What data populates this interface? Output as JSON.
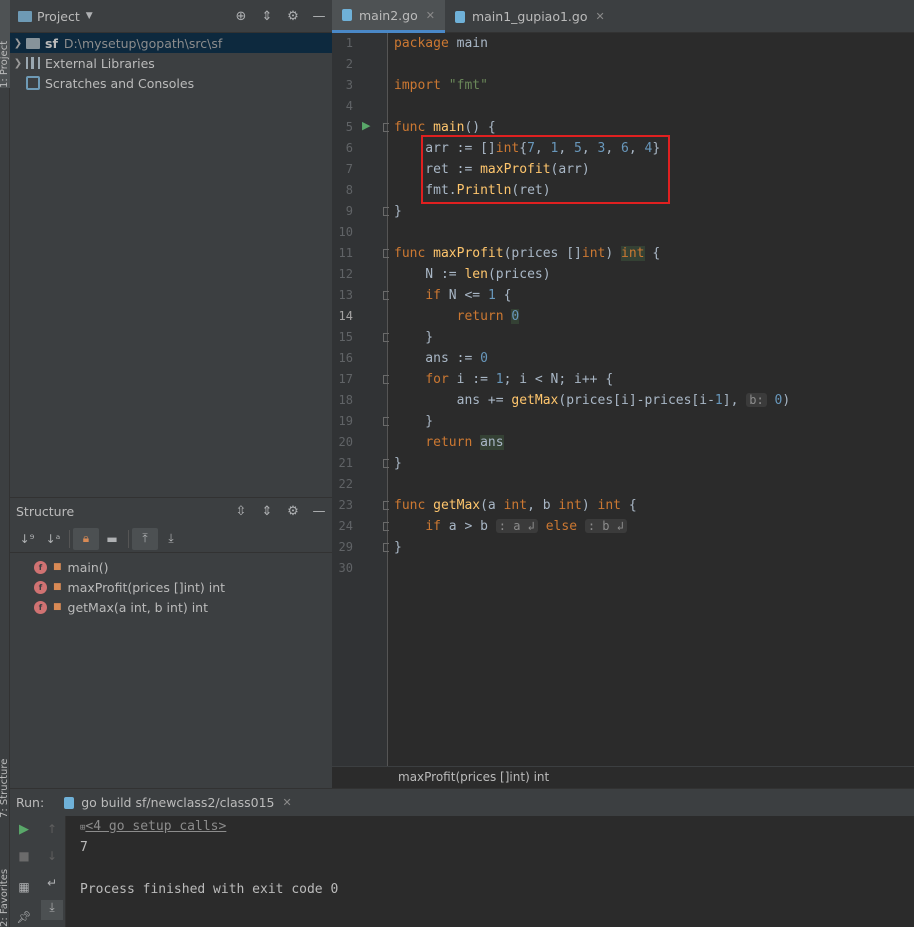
{
  "left_strip": {
    "project_tab": "1: Project",
    "structure_tab": "7: Structure",
    "favorites_tab": "2: Favorites"
  },
  "project": {
    "title": "Project",
    "tree": [
      {
        "name": "sf",
        "path": "D:\\mysetup\\gopath\\src\\sf"
      },
      {
        "name": "External Libraries"
      },
      {
        "name": "Scratches and Consoles"
      }
    ]
  },
  "structure": {
    "title": "Structure",
    "items": [
      {
        "badge": "f",
        "label": "main()"
      },
      {
        "badge": "f",
        "label": "maxProfit(prices []int) int"
      },
      {
        "badge": "f",
        "label": "getMax(a int, b int) int"
      }
    ]
  },
  "editor": {
    "tabs": [
      {
        "label": "main2.go",
        "active": true
      },
      {
        "label": "main1_gupiao1.go",
        "active": false
      }
    ],
    "current_line": 14,
    "line_numbers": [
      "1",
      "2",
      "3",
      "4",
      "5",
      "6",
      "7",
      "8",
      "9",
      "10",
      "11",
      "12",
      "13",
      "14",
      "15",
      "16",
      "17",
      "18",
      "19",
      "20",
      "21",
      "22",
      "23",
      "24",
      "29",
      "30"
    ],
    "code": {
      "l1": [
        "package",
        " main"
      ],
      "l3": [
        "import",
        " ",
        "\"fmt\""
      ],
      "l5": [
        "func",
        " ",
        "main",
        "() {"
      ],
      "l6": [
        "    arr := []",
        "int",
        "{",
        "7",
        ", ",
        "1",
        ", ",
        "5",
        ", ",
        "3",
        ", ",
        "6",
        ", ",
        "4",
        "}"
      ],
      "l7": [
        "    ret := ",
        "maxProfit",
        "(arr)"
      ],
      "l8": [
        "    fmt.",
        "Println",
        "(ret)"
      ],
      "l9": [
        "}"
      ],
      "l11": [
        "func",
        " ",
        "maxProfit",
        "(prices []",
        "int",
        ") ",
        "int",
        " {"
      ],
      "l12": [
        "    N := ",
        "len",
        "(prices)"
      ],
      "l13": [
        "    ",
        "if",
        " N <= ",
        "1",
        " {"
      ],
      "l14": [
        "        ",
        "return",
        " ",
        "0"
      ],
      "l15": [
        "    }"
      ],
      "l16": [
        "    ans := ",
        "0"
      ],
      "l17": [
        "    ",
        "for",
        " i := ",
        "1",
        "; i < N; i++ {"
      ],
      "l18": [
        "        ans += ",
        "getMax",
        "(prices[i]-prices[i-",
        "1",
        "], ",
        "b:",
        " ",
        "0",
        ")"
      ],
      "l19": [
        "    }"
      ],
      "l20": [
        "    ",
        "return",
        " ",
        "ans"
      ],
      "l21": [
        "}"
      ],
      "l23": [
        "func",
        " ",
        "getMax",
        "(a ",
        "int",
        ", b ",
        "int",
        ") ",
        "int",
        " {"
      ],
      "l24": [
        "    ",
        "if",
        " a > b ",
        ": a ↲",
        " ",
        "else",
        " ",
        ": b ↲"
      ],
      "l29": [
        "}"
      ]
    }
  },
  "breadcrumb": "maxProfit(prices []int) int",
  "run": {
    "label": "Run:",
    "tab": "go build sf/newclass2/class015",
    "console": [
      "<4 go setup calls>",
      "7",
      "",
      "Process finished with exit code 0"
    ]
  },
  "colors": {
    "highlight_box": "#e02020",
    "keyword": "#cc7832",
    "function": "#ffc66d",
    "number": "#6897bb",
    "string": "#6a8759"
  }
}
